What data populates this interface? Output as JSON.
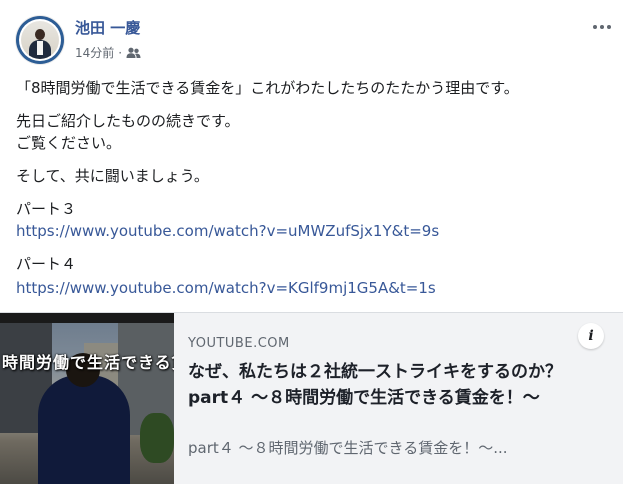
{
  "post": {
    "author": "池田 一慶",
    "time": "14分前",
    "separator": "·",
    "audience_icon": "friends-icon",
    "body": {
      "line1": "「8時間労働で生活できる賃金を」これがわたしたちのたたかう理由です。",
      "line2": "先日ご紹介したものの続きです。",
      "line3": "ご覧ください。",
      "line4": "そして、共に闘いましょう。",
      "part3_label": "パート３",
      "part3_link": "https://www.youtube.com/watch?v=uMWZufSjx1Y&t=9s",
      "part4_label": "パート４",
      "part4_link": "https://www.youtube.com/watch?v=KGlf9mj1G5A&t=1s"
    }
  },
  "preview": {
    "domain": "YOUTUBE.COM",
    "title": "なぜ、私たちは２社統一ストライキをするのか？ part４ ～８時間労働で生活できる賃金を！～",
    "description": "part４ ～８時間労働で生活できる賃金を！～...",
    "thumbnail_caption": "時間労働で生活できる賃金を！",
    "info_glyph": "i"
  },
  "colors": {
    "author": "#385898",
    "link": "#385898",
    "text": "#1c1e21",
    "meta": "#606770",
    "preview_bg": "#f2f3f5"
  }
}
